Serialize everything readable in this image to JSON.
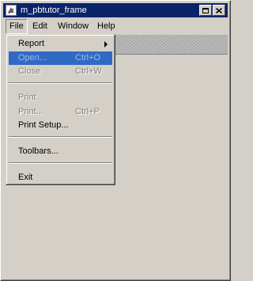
{
  "window": {
    "title": "m_pbtutor_frame"
  },
  "menubar": {
    "items": [
      {
        "label": "File"
      },
      {
        "label": "Edit"
      },
      {
        "label": "Window"
      },
      {
        "label": "Help"
      }
    ]
  },
  "file_menu": {
    "items": [
      {
        "label": "Report",
        "shortcut": "",
        "has_submenu": true,
        "enabled": true
      },
      {
        "label": "Open...",
        "shortcut": "Ctrl+O",
        "enabled": false,
        "highlighted": true
      },
      {
        "label": "Close",
        "shortcut": "Ctrl+W",
        "enabled": false
      },
      {
        "label": "Print",
        "shortcut": "",
        "enabled": false
      },
      {
        "label": "Print...",
        "shortcut": "Ctrl+P",
        "enabled": false
      },
      {
        "label": "Print Setup...",
        "shortcut": "",
        "enabled": true
      },
      {
        "label": "Toolbars...",
        "shortcut": "",
        "enabled": true
      },
      {
        "label": "Exit",
        "shortcut": "",
        "enabled": true
      }
    ]
  },
  "colors": {
    "titlebar": "#0a246a",
    "highlight": "#316ac5",
    "face": "#d4d0c8"
  }
}
